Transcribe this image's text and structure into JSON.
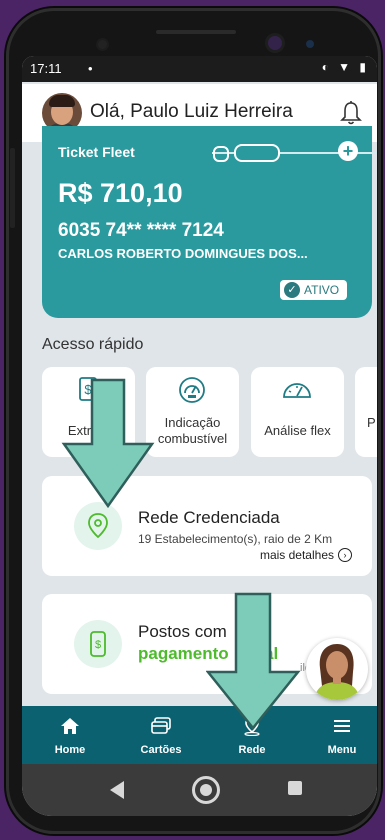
{
  "status_bar": {
    "time": "17:11",
    "indicator": "•",
    "icons": "◐ ▼ ▮"
  },
  "header": {
    "greeting": "Olá, Paulo Luiz Herreira"
  },
  "card": {
    "brand": "Ticket Fleet",
    "balance": "R$ 710,10",
    "number": "6035 74** **** 7124",
    "holder": "CARLOS ROBERTO DOMINGUES DOS...",
    "status": "ATIVO",
    "color": "#2b9a9f"
  },
  "quick_access": {
    "title": "Acesso rápido",
    "items": [
      {
        "label": "Extrato",
        "icon": "receipt-icon"
      },
      {
        "label": "Indicação combustível",
        "icon": "gauge-icon"
      },
      {
        "label": "Análise flex",
        "icon": "speedometer-icon"
      },
      {
        "label": "P",
        "icon": "more-icon"
      }
    ]
  },
  "rede_card": {
    "title": "Rede Credenciada",
    "subtitle": "19 Estabelecimento(s), raio de 2 Km",
    "more": "mais detalhes"
  },
  "postos_card": {
    "title": "Postos com",
    "highlight": "pagamento",
    "highlight_tail": "al",
    "faint": "ile"
  },
  "tabs": [
    {
      "label": "Home",
      "icon": "home-icon"
    },
    {
      "label": "Cartões",
      "icon": "cards-icon"
    },
    {
      "label": "Rede",
      "icon": "location-pin-icon"
    },
    {
      "label": "Menu",
      "icon": "hamburger-icon"
    }
  ],
  "colors": {
    "accent": "#2b9a9f",
    "tabbar": "#0b6170",
    "green": "#4dbb2c",
    "background": "#4b2466"
  }
}
